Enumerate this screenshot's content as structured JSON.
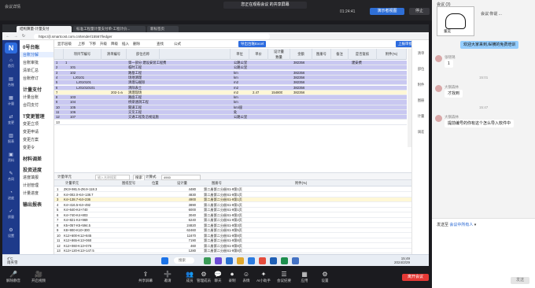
{
  "meeting": {
    "recording_label": "会议详情",
    "center_banner": "您正在观看会议 的共享屏幕",
    "timer": "01:24:41",
    "host_badge": "演示者视图",
    "stop_label": "停止",
    "bottom_buttons": [
      {
        "label": "解除静音",
        "icon": "mic-off-icon"
      },
      {
        "label": "开启视频",
        "icon": "camera-off-icon"
      },
      {
        "label": "共享屏幕",
        "icon": "share-icon"
      },
      {
        "label": "邀请",
        "icon": "invite-icon"
      },
      {
        "label": "成员",
        "icon": "members-icon"
      },
      {
        "label": "管理成员",
        "icon": "manage-icon"
      },
      {
        "label": "聊天",
        "icon": "chat-icon"
      },
      {
        "label": "录制",
        "icon": "record-icon"
      },
      {
        "label": "表情",
        "icon": "emoji-icon"
      },
      {
        "label": "AI小助手",
        "icon": "ai-icon"
      },
      {
        "label": "会议纪要",
        "icon": "notes-icon"
      },
      {
        "label": "应用",
        "icon": "apps-icon"
      },
      {
        "label": "设置",
        "icon": "settings-icon"
      }
    ],
    "end_label": "离开会议"
  },
  "browser": {
    "tabs": [
      "结构算量-计量支付",
      "标准工程量计量支付单-工程计价...",
      "新标签页"
    ],
    "url": "https://jl.smartcost.com.cn/tender/15567/ledger"
  },
  "rail": {
    "items": [
      "首页",
      "台账",
      "计量",
      "变更",
      "报表",
      "资料",
      "合同",
      "进度",
      "质量",
      "设置"
    ]
  },
  "nav": {
    "items": [
      {
        "label": "0号台账",
        "head": true
      },
      {
        "label": "台账分解",
        "sel": true
      },
      {
        "label": "台账审批"
      },
      {
        "label": "清单汇总"
      },
      {
        "label": "台账修订"
      },
      {
        "label": "计量支付",
        "head": true
      },
      {
        "label": "计量台账"
      },
      {
        "label": "合同支付"
      },
      {
        "label": "T变更管理",
        "head": true
      },
      {
        "label": "变更立项"
      },
      {
        "label": "变更申请"
      },
      {
        "label": "变更方案"
      },
      {
        "label": "变更令"
      },
      {
        "label": "材料调差",
        "head": true
      },
      {
        "label": "投资进度",
        "head": true
      },
      {
        "label": "进度填报"
      },
      {
        "label": "计划管理"
      },
      {
        "label": "计量进度"
      },
      {
        "label": "输出报表",
        "head": true
      }
    ]
  },
  "sheet": {
    "toolbar": [
      "显示层级",
      "上移",
      "下移",
      "升级",
      "降级",
      "插入",
      "删除",
      "查找",
      "公式"
    ],
    "btn_excel": "导出台账Excel",
    "btn_save": "上报审批",
    "headers": [
      "项目节编号",
      "清单编号",
      "部位名称",
      "单位",
      "单价",
      "数量",
      "金额",
      "图册号",
      "备注",
      "是否复核",
      "附件(%)"
    ],
    "header_sub": "设计量",
    "rows": [
      {
        "n": "1",
        "code": "1",
        "name": "第一部分 建设安装工程费",
        "unit": "公路公里",
        "amt": "382356",
        "note": "建安费",
        "c": "blue"
      },
      {
        "n": "2",
        "code": "101",
        "name": "临时工程",
        "unit": "公路公里",
        "c": "blue"
      },
      {
        "n": "3",
        "code": "102",
        "name": "路基工程",
        "unit": "km",
        "amt": "382356",
        "c": "blue"
      },
      {
        "n": "4",
        "code": "LJ0101",
        "name": "场地清理",
        "unit": "km",
        "amt": "382356",
        "c": "blue"
      },
      {
        "n": "5",
        "code": "LJ010101",
        "name": "清理与掘除",
        "unit": "m2",
        "amt": "382356",
        "c": "blue"
      },
      {
        "n": "6",
        "code": "LJ01010101",
        "name": "清除表土",
        "unit": "m2",
        "amt": "382356",
        "c": "blue"
      },
      {
        "n": "7",
        "code": "",
        "bill": "202-1-a",
        "name": "清理现场",
        "unit": "m2",
        "price": "2.47",
        "qty": "154800",
        "amt": "382356",
        "c": "hl"
      },
      {
        "n": "8",
        "code": "103",
        "name": "路面工程",
        "unit": "km",
        "c": "blue"
      },
      {
        "n": "9",
        "code": "104",
        "name": "桥梁涵洞工程",
        "unit": "km",
        "c": "blue"
      },
      {
        "n": "10",
        "code": "105",
        "name": "隧道工程",
        "unit": "km/座",
        "c": "blue"
      },
      {
        "n": "11",
        "code": "106",
        "name": "交叉工程",
        "unit": "处",
        "c": "blue"
      },
      {
        "n": "12",
        "code": "107",
        "name": "交通工程及沿线设施",
        "unit": "公路公里",
        "c": "blue"
      },
      {
        "n": "13",
        "code": "",
        "name": "",
        "unit": "",
        "c": ""
      }
    ],
    "right_tabs": [
      "清单",
      "部位",
      "附件",
      "图册",
      "计量",
      "调差"
    ],
    "bottom_bar": {
      "label": "计量单元",
      "search_placeholder": "输入名称搜索",
      "btn_search": "搜索",
      "formula_label": "计算式",
      "formula_value": "4900"
    },
    "bottom_headers": [
      "计量单元",
      "图纸型号",
      "位置",
      "设计量",
      "图册号",
      "附件(%)"
    ],
    "bottom_rows": [
      {
        "n": "1",
        "u": "ZK3+981.5-ZK4+118.3",
        "qty": "4480",
        "book": "第二册第二分册S1-9第1页"
      },
      {
        "n": "2",
        "u": "K4+002.0-K4+138.7",
        "qty": "4830",
        "book": "第二册第二分册S1-9第1页"
      },
      {
        "n": "3",
        "u": "K4+138.7-K4+236",
        "qty": "4900",
        "book": "第二册第二分册S1-9第1页",
        "hl": true
      },
      {
        "n": "4",
        "u": "K4+416.5-K4+492",
        "qty": "3890",
        "book": "第二册第二分册S1-9第1页"
      },
      {
        "n": "5",
        "u": "K4+640-K4+740",
        "qty": "6000",
        "book": "第二册第二分册S1-9第1页"
      },
      {
        "n": "6",
        "u": "K4+740-K4+803",
        "qty": "3040",
        "book": "第二册第二分册S1-9第2页"
      },
      {
        "n": "7",
        "u": "K4+821-K4+969",
        "qty": "6240",
        "book": "第二册第二分册S1-9第2页"
      },
      {
        "n": "8",
        "u": "K5+057-K5+594.5",
        "qty": "24820",
        "book": "第二册第二分册S1-9第3页"
      },
      {
        "n": "9",
        "u": "K8+900-K10+300",
        "qty": "62460",
        "book": "第二册第二分册S1-9第5页"
      },
      {
        "n": "10",
        "u": "K12+600-K12+845",
        "qty": "11670",
        "book": "第二册第二分册S1-9第8页"
      },
      {
        "n": "11",
        "u": "K12+865-K13+060",
        "qty": "7190",
        "book": "第二册第二分册S1-9第8页"
      },
      {
        "n": "12",
        "u": "K12+060-K13+076",
        "qty": "460",
        "book": "第二册第二分册S1-9第8页"
      },
      {
        "n": "13",
        "u": "K13+120-K13+147.5",
        "qty": "1280",
        "book": "第二册第二分册S1-9第8页"
      }
    ]
  },
  "taskbar": {
    "weather_temp": "4°C",
    "weather_desc": "雨夹雪",
    "search": "搜索",
    "time": "15:49",
    "date": "2024/2/29"
  },
  "chat": {
    "top_title": "会议 (3)",
    "topic": "会议:你说 ...",
    "avatar_label": "董奕",
    "messages": [
      {
        "side": "right",
        "text": "欢迎大家来到,纵横的免费培训"
      },
      {
        "side": "left",
        "name": "张晓璐",
        "text": "1"
      },
      {
        "side": "time",
        "text": "15:01"
      },
      {
        "side": "left",
        "name": "大钢森林",
        "text": "才找到"
      },
      {
        "side": "time",
        "text": "15:47"
      },
      {
        "side": "left",
        "name": "大钢森林",
        "text": "提前编号的你有这个怎么导入软件中"
      }
    ],
    "send_to_label": "发送至",
    "send_to_value": "会议中所有人",
    "send_btn": "发送"
  }
}
